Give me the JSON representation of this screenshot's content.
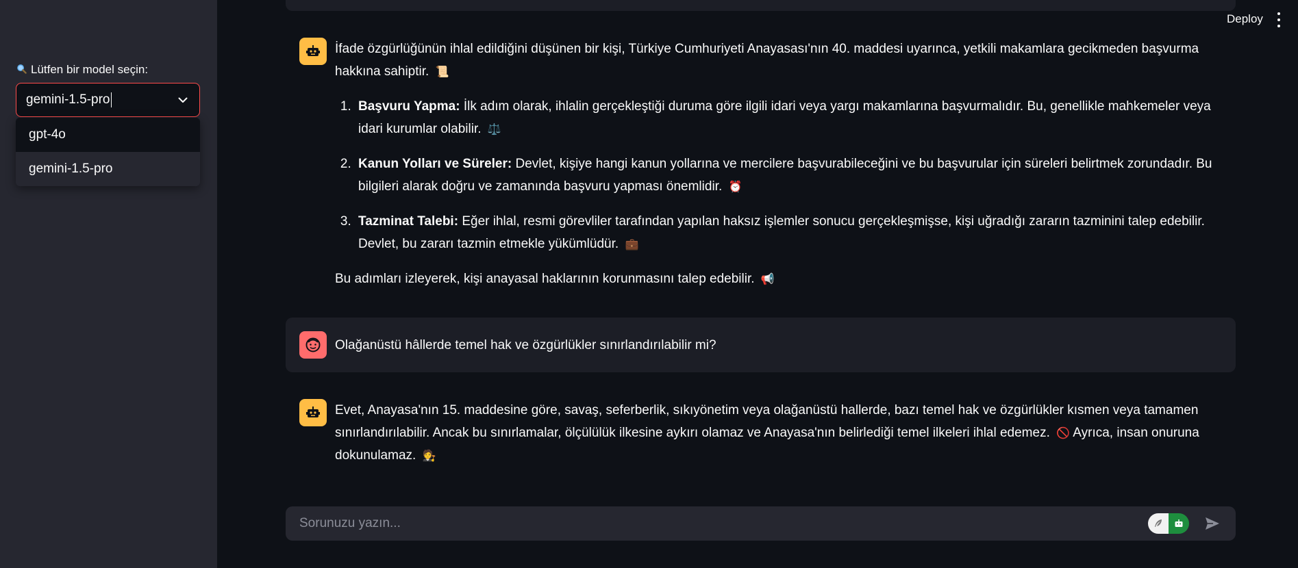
{
  "sidebar": {
    "model_label": "Lütfen bir model seçin:",
    "label_icon": "magnifier-icon",
    "selected_value": "gemini-1.5-pro",
    "options": [
      "gpt-4o",
      "gemini-1.5-pro"
    ]
  },
  "header": {
    "deploy_label": "Deploy",
    "menu_icon": "vertical-dots-icon"
  },
  "messages": [
    {
      "role": "assistant",
      "intro": "İfade özgürlüğünün ihlal edildiğini düşünen bir kişi, Türkiye Cumhuriyeti Anayasası'nın 40. maddesi uyarınca, yetkili makamlara gecikmeden başvurma hakkına sahiptir.",
      "intro_emoji": "📜",
      "items": [
        {
          "title": "Başvuru Yapma:",
          "text": "İlk adım olarak, ihlalin gerçekleştiği duruma göre ilgili idari veya yargı makamlarına başvurmalıdır. Bu, genellikle mahkemeler veya idari kurumlar olabilir.",
          "emoji": "⚖️"
        },
        {
          "title": "Kanun Yolları ve Süreler:",
          "text": "Devlet, kişiye hangi kanun yollarına ve mercilere başvurabileceğini ve bu başvurular için süreleri belirtmek zorundadır. Bu bilgileri alarak doğru ve zamanında başvuru yapması önemlidir.",
          "emoji": "⏰"
        },
        {
          "title": "Tazminat Talebi:",
          "text": "Eğer ihlal, resmi görevliler tarafından yapılan haksız işlemler sonucu gerçekleşmişse, kişi uğradığı zararın tazminini talep edebilir. Devlet, bu zararı tazmin etmekle yükümlüdür.",
          "emoji": "💼"
        }
      ],
      "outro": "Bu adımları izleyerek, kişi anayasal haklarının korunmasını talep edebilir.",
      "outro_emoji": "📢"
    },
    {
      "role": "user",
      "text": "Olağanüstü hâllerde temel hak ve özgürlükler sınırlandırılabilir mi?"
    },
    {
      "role": "assistant",
      "text_a": "Evet, Anayasa'nın 15. maddesine göre, savaş, seferberlik, sıkıyönetim veya olağanüstü hallerde, bazı temel hak ve özgürlükler kısmen veya tamamen sınırlandırılabilir. Ancak bu sınırlamalar, ölçülülük ilkesine aykırı olamaz ve Anayasa'nın belirlediği temel ilkeleri ihlal edemez.",
      "emoji_a": "🚫",
      "text_b": "Ayrıca, insan onuruna dokunulamaz.",
      "emoji_b": "🧑‍⚖️"
    }
  ],
  "chat_input": {
    "placeholder": "Sorunuzu yazın...",
    "value": ""
  },
  "colors": {
    "background": "#0e1117",
    "sidebar": "#262730",
    "accent": "#ff4b4b",
    "bot_avatar": "#ffbd45",
    "user_avatar": "#ff6c6c"
  }
}
